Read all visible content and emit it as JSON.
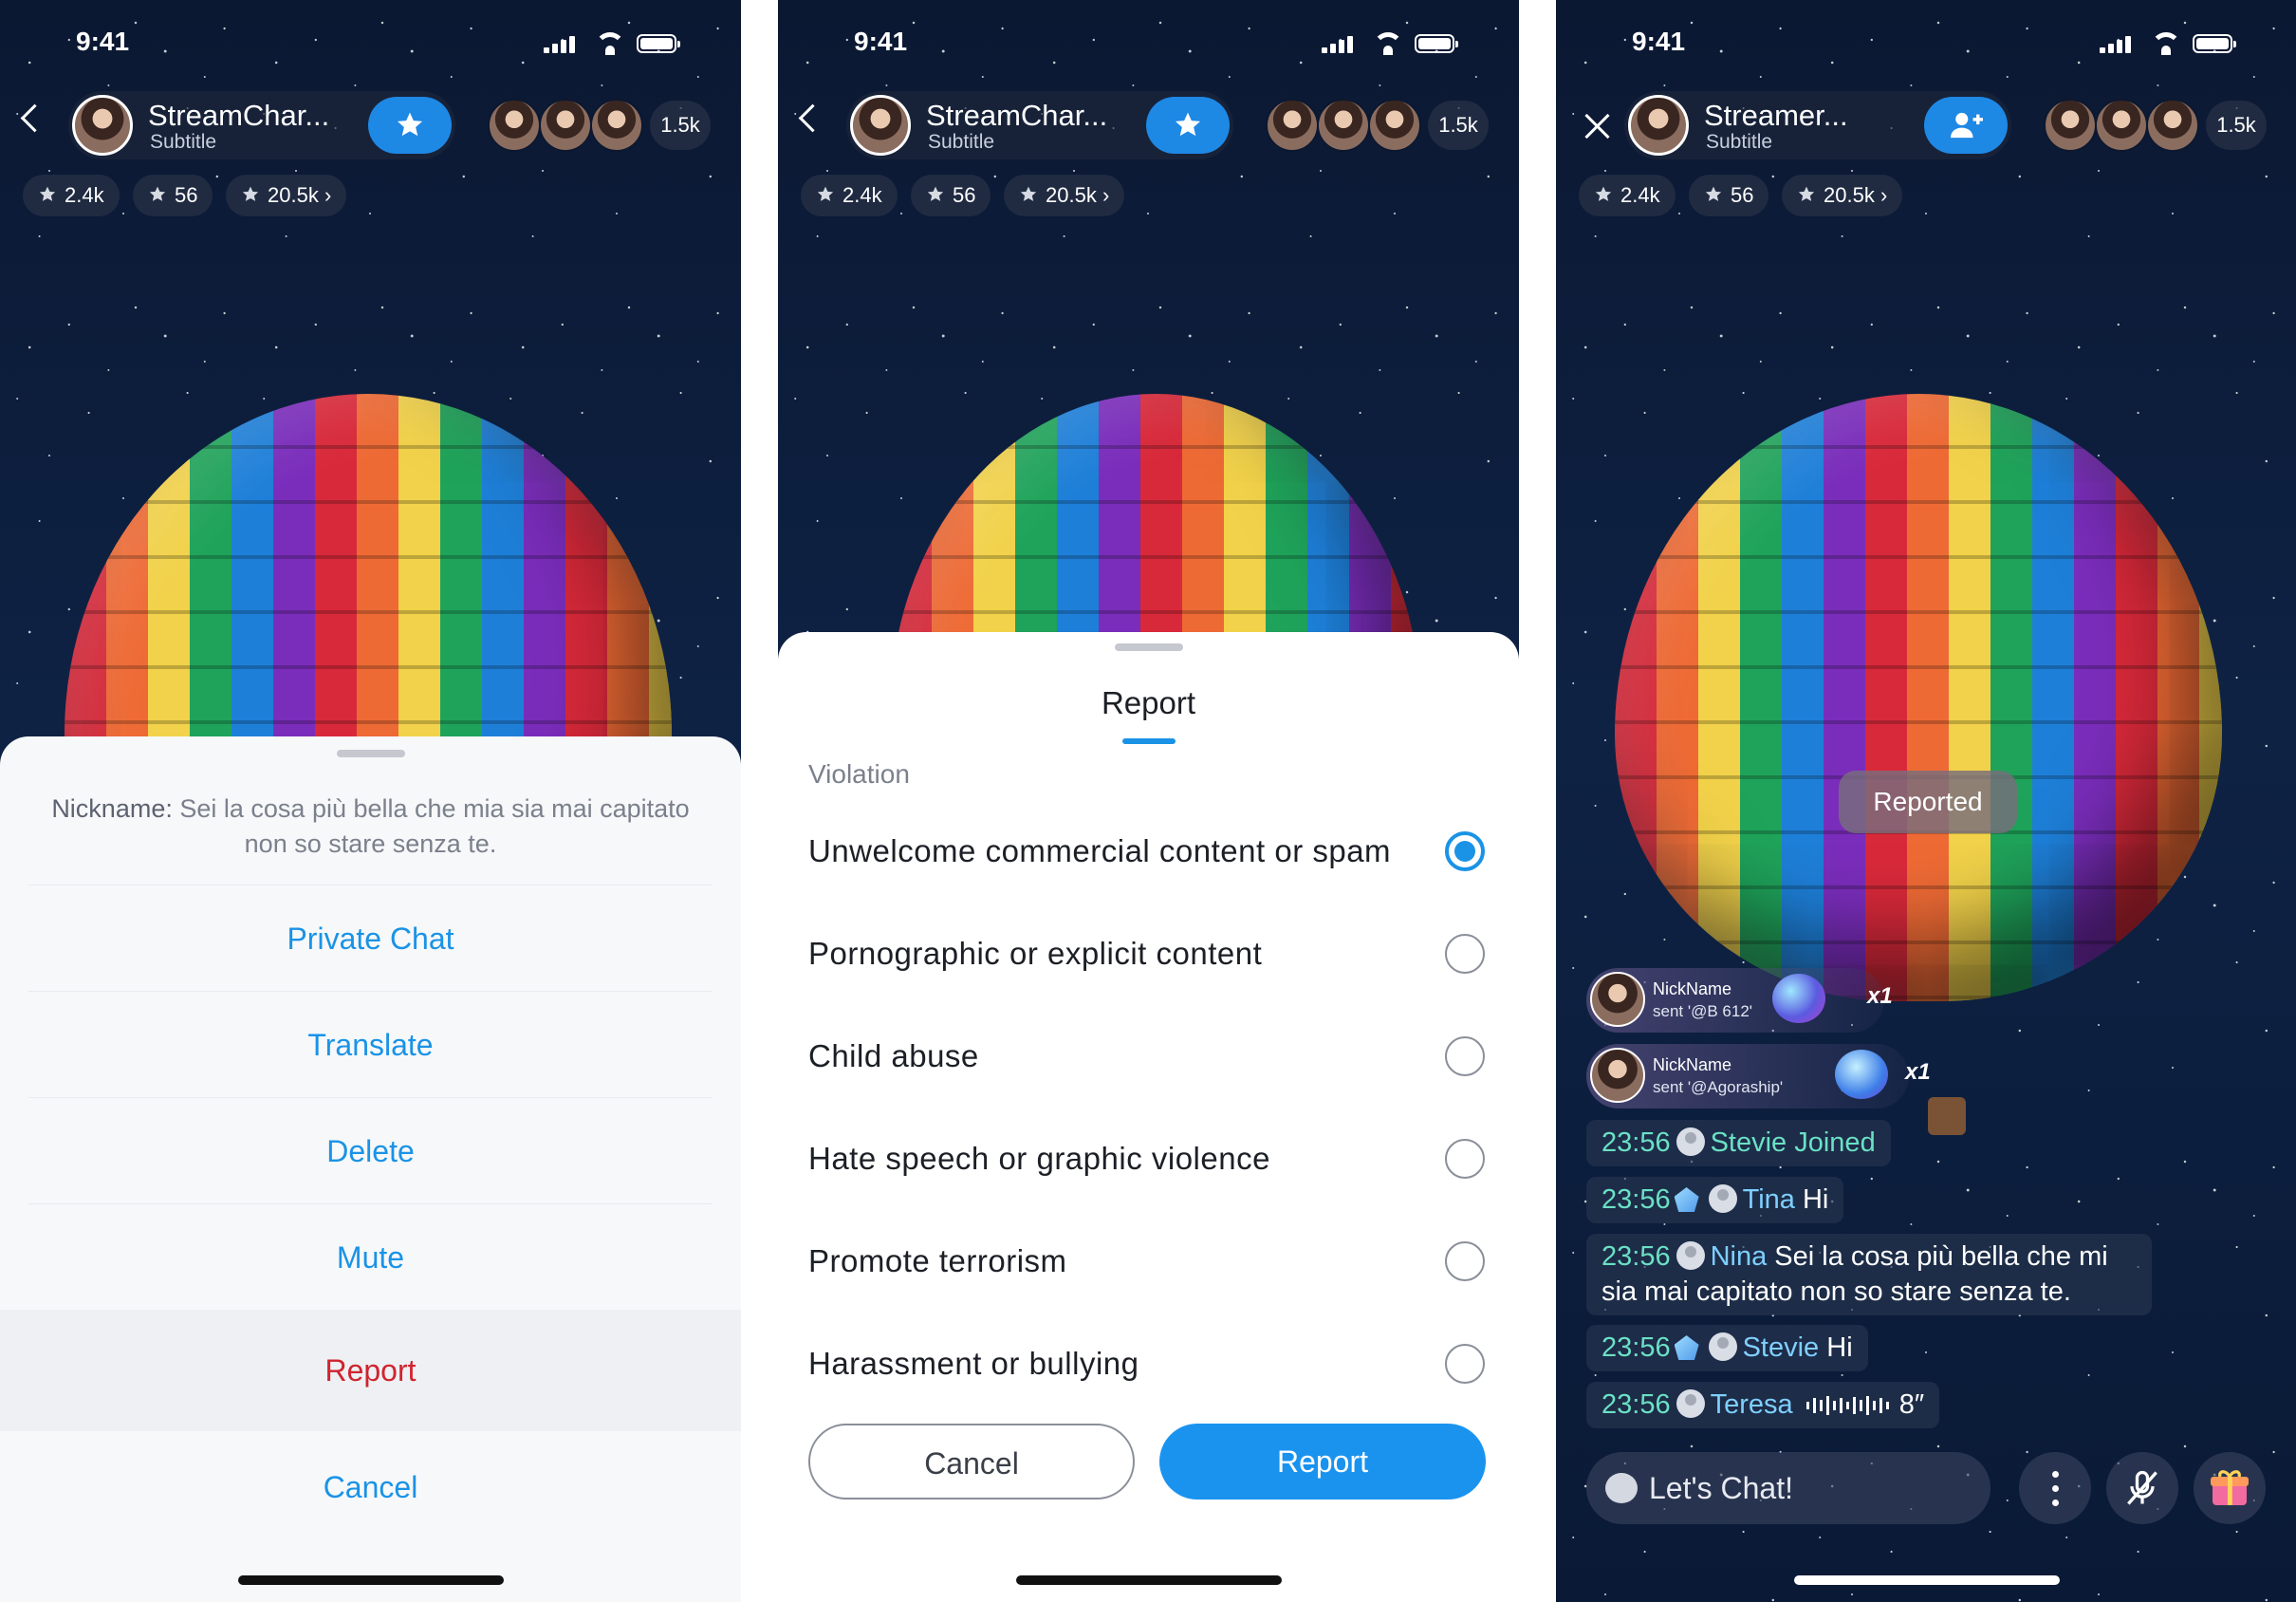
{
  "status": {
    "time": "9:41"
  },
  "header": {
    "host_name_short": "StreamChar...",
    "host_name_short_3": "Streamer...",
    "host_subtitle": "Subtitle",
    "viewer_count": "1.5k",
    "stats": [
      "2.4k",
      "56",
      "20.5k"
    ]
  },
  "screen1": {
    "quote_name": "Nickname:",
    "quote_text": "Sei la cosa più bella che mia sia mai capitato non so stare senza te.",
    "actions": [
      "Private Chat",
      "Translate",
      "Delete",
      "Mute",
      "Report",
      "Cancel"
    ]
  },
  "screen2": {
    "title": "Report",
    "section": "Violation",
    "options": [
      "Unwelcome commercial content or spam",
      "Pornographic or explicit content",
      "Child abuse",
      "Hate speech or graphic violence",
      "Promote terrorism",
      "Harassment or bullying"
    ],
    "selected_index": 0,
    "cancel": "Cancel",
    "submit": "Report"
  },
  "screen3": {
    "toast": "Reported",
    "gifts": [
      {
        "name": "NickName",
        "sent": "sent '@B 612'",
        "mult": "x1"
      },
      {
        "name": "NickName",
        "sent": "sent '@Agoraship'",
        "mult": "x1"
      }
    ],
    "messages": {
      "m1": {
        "time": "23:56",
        "text": "Stevie Joined"
      },
      "m2": {
        "time": "23:56",
        "name": "Tina",
        "text": "Hi"
      },
      "m3": {
        "time": "23:56",
        "name": "Nina",
        "text": "Sei la cosa più bella che mi",
        "text2": "sia mai capitato non so stare senza te."
      },
      "m4": {
        "time": "23:56",
        "name": "Stevie",
        "text": "Hi"
      },
      "m5": {
        "time": "23:56",
        "name": "Teresa",
        "duration": "8″"
      }
    },
    "chat_placeholder": "Let's Chat!"
  },
  "colors": {
    "accent": "#1a93e6",
    "danger": "#d0242f",
    "time_green": "#6be0c5"
  }
}
